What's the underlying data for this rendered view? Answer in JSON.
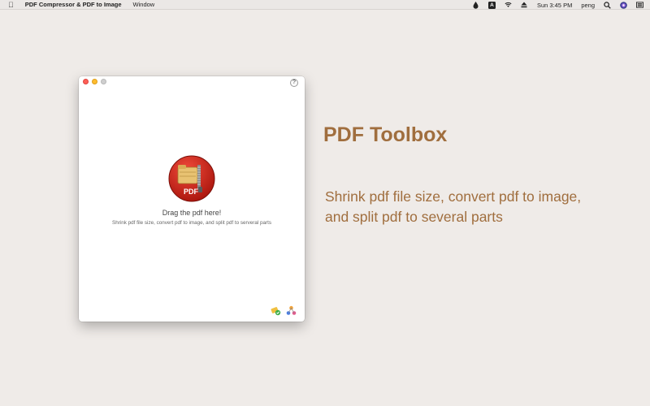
{
  "menubar": {
    "app_name": "PDF Compressor & PDF to Image",
    "menus": [
      "Window"
    ],
    "status": {
      "keyboard_indicator": "A",
      "clock": "Sun 3:45 PM",
      "user": "peng"
    }
  },
  "window": {
    "help_label": "?",
    "drop_title": "Drag the pdf here!",
    "drop_subtitle": "Shrink pdf file size, convert pdf to image, and split pdf to serveral parts",
    "icon_badge": "PDF"
  },
  "promo": {
    "title": "PDF Toolbox",
    "line1": "Shrink pdf file size, convert pdf to image,",
    "line2": "and split pdf to several parts"
  },
  "colors": {
    "background": "#efebe8",
    "accent_text": "#a06e3e",
    "icon_red": "#d42a1e"
  }
}
